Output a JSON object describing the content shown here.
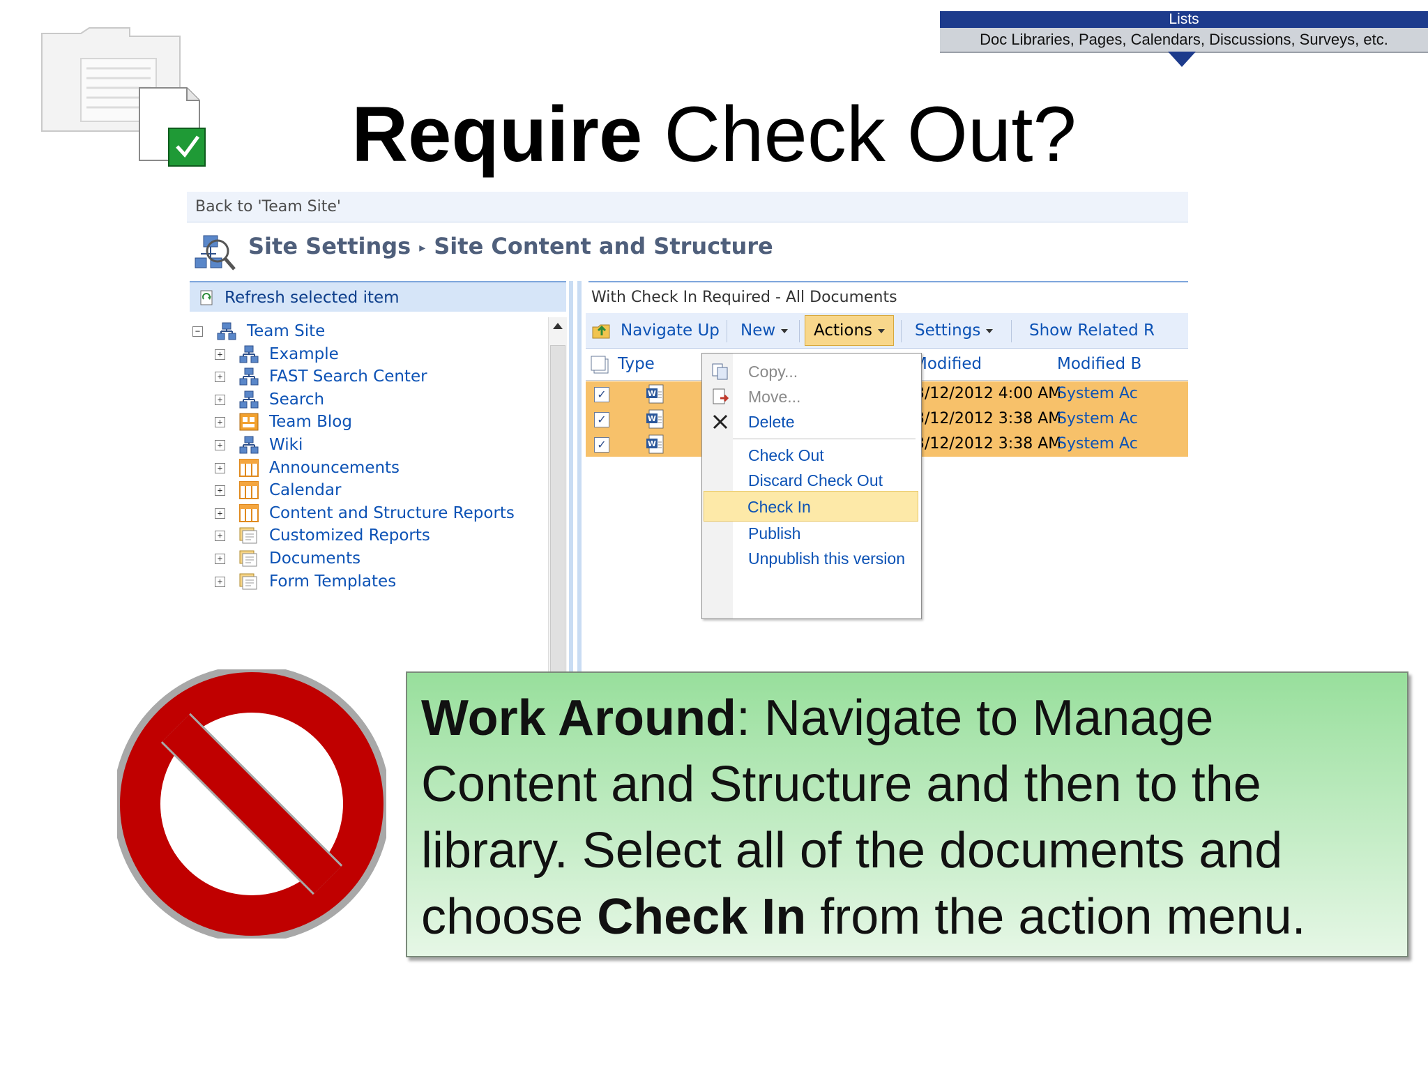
{
  "banner": {
    "top": "Lists",
    "bottom": "Doc Libraries, Pages, Calendars, Discussions, Surveys, etc."
  },
  "title": {
    "bold": "Require",
    "rest": " Check Out?"
  },
  "sharepoint": {
    "back_link": "Back to 'Team Site'",
    "breadcrumb": {
      "first": "Site Settings",
      "second": "Site Content and Structure"
    },
    "left_bar": "Refresh selected item",
    "tree": [
      {
        "label": "Team Site",
        "level": 0,
        "icon": "site-icon",
        "expand": "−"
      },
      {
        "label": "Example",
        "level": 1,
        "icon": "site-icon",
        "expand": "+"
      },
      {
        "label": "FAST Search Center",
        "level": 1,
        "icon": "site-icon",
        "expand": "+"
      },
      {
        "label": "Search",
        "level": 1,
        "icon": "site-icon",
        "expand": "+"
      },
      {
        "label": "Team Blog",
        "level": 1,
        "icon": "blog-icon",
        "expand": "+"
      },
      {
        "label": "Wiki",
        "level": 1,
        "icon": "site-icon",
        "expand": "+"
      },
      {
        "label": "Announcements",
        "level": 1,
        "icon": "list-icon",
        "expand": "+"
      },
      {
        "label": "Calendar",
        "level": 1,
        "icon": "list-icon",
        "expand": "+"
      },
      {
        "label": "Content and Structure Reports",
        "level": 1,
        "icon": "list-icon",
        "expand": "+"
      },
      {
        "label": "Customized Reports",
        "level": 1,
        "icon": "library-icon",
        "expand": "+"
      },
      {
        "label": "Documents",
        "level": 1,
        "icon": "library-icon",
        "expand": "+"
      },
      {
        "label": "Form Templates",
        "level": 1,
        "icon": "library-icon",
        "expand": "+"
      }
    ],
    "view_title": "With Check In Required - All Documents",
    "toolbar": {
      "navigate_up": "Navigate Up",
      "new": "New",
      "actions": "Actions",
      "settings": "Settings",
      "show_related": "Show Related R"
    },
    "columns": {
      "type": "Type",
      "modified": "Modified",
      "modified_by": "Modified B"
    },
    "rows": [
      {
        "checked": "✓",
        "modified": "3/12/2012 4:00 AM",
        "modified_by": "System Ac"
      },
      {
        "checked": "✓",
        "modified": "3/12/2012 3:38 AM",
        "modified_by": "System Ac"
      },
      {
        "checked": "✓",
        "modified": "3/12/2012 3:38 AM",
        "modified_by": "System Ac"
      }
    ],
    "menu": {
      "copy": "Copy...",
      "move": "Move...",
      "delete": "Delete",
      "check_out": "Check Out",
      "discard_check_out": "Discard Check Out",
      "check_in": "Check In",
      "publish": "Publish",
      "unpublish": "Unpublish this version"
    }
  },
  "callout": {
    "p1_bold": "Work Around",
    "p1_rest": ": Navigate to Manage Content and Structure and then to the library. Select all of the documents and choose ",
    "p2_bold": "Check In",
    "p2_rest": " from the action menu."
  },
  "colors": {
    "no_sign_red": "#c00000",
    "callout_green": "#98df9c",
    "selected_row": "#f7c16a"
  }
}
